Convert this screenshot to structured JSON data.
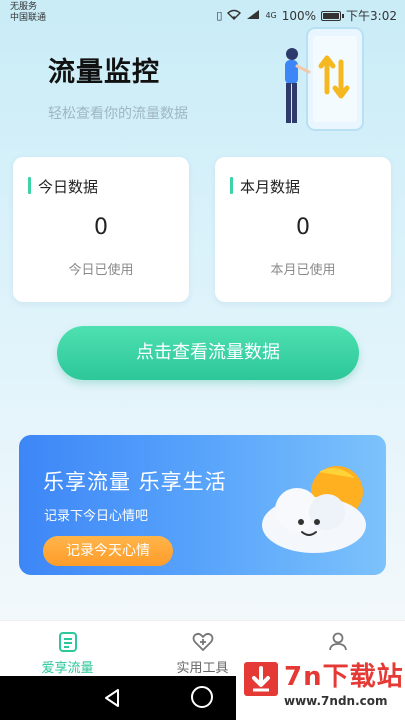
{
  "status_bar": {
    "carrier_line1": "无服务",
    "carrier_line2": "中国联通",
    "network": "4G",
    "battery": "100%",
    "time": "下午3:02"
  },
  "header": {
    "title": "流量监控",
    "subtitle": "轻松查看你的流量数据"
  },
  "cards": [
    {
      "label": "今日数据",
      "value": "0",
      "caption": "今日已使用"
    },
    {
      "label": "本月数据",
      "value": "0",
      "caption": "本月已使用"
    }
  ],
  "main_button": {
    "label": "点击查看流量数据"
  },
  "banner": {
    "title": "乐享流量 乐享生活",
    "subtitle": "记录下今日心情吧",
    "button": "记录今天心情"
  },
  "bottom_nav": {
    "items": [
      {
        "label": "爱享流量",
        "icon": "document-icon",
        "active": true
      },
      {
        "label": "实用工具",
        "icon": "heart-plus-icon",
        "active": false
      },
      {
        "label": "",
        "icon": "user-icon",
        "active": false
      }
    ]
  },
  "watermark": {
    "text": "7n下载站",
    "url": "www.7ndn.com"
  },
  "colors": {
    "accent_green": "#2cc79a",
    "banner_blue": "#3d86f7",
    "banner_orange": "#ff9c2a",
    "watermark_red": "#e53935"
  }
}
